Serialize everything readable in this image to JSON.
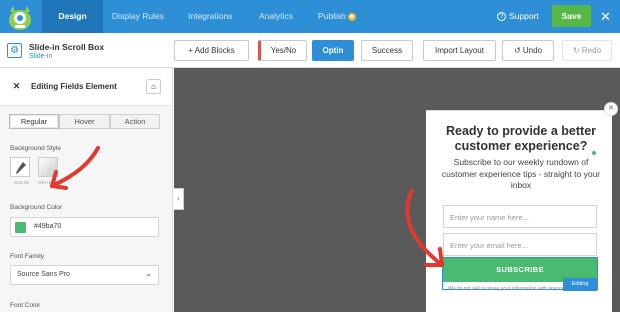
{
  "nav": {
    "tabs": [
      {
        "label": "Design",
        "active": true
      },
      {
        "label": "Display Rules"
      },
      {
        "label": "Integrations"
      },
      {
        "label": "Analytics"
      },
      {
        "label": "Publish"
      }
    ],
    "support_label": "Support",
    "save_label": "Save",
    "close_label": "✕",
    "brand_color": "#2e8fd6",
    "save_color": "#57b847"
  },
  "toolbar": {
    "campaign_name": "Slide-in Scroll Box",
    "campaign_type": "Slide-in",
    "add_blocks_label": "+ Add Blocks",
    "yes_no_label": "Yes/No",
    "optin_label": "Optin",
    "success_label": "Success",
    "import_layout_label": "Import Layout",
    "undo_label": "↺ Undo",
    "redo_label": "↻ Redo"
  },
  "sidebar": {
    "title": "Editing Fields Element",
    "tabs": [
      "Regular",
      "Hover",
      "Action"
    ],
    "background_style_label": "Background Style",
    "style_options": [
      "SOLID",
      "GRADIENT"
    ],
    "background_color_label": "Background Color",
    "background_color_value": "#49ba70",
    "font_family_label": "Font Family",
    "font_family_value": "Source Sans Pro",
    "font_color_label": "Font Color"
  },
  "preview": {
    "title": "Ready to provide a better customer experience?",
    "subtitle": "Subscribe to our weekly rundown of customer experience tips - straight to your inbox",
    "name_placeholder": "Enter your name here...",
    "email_placeholder": "Enter your email here...",
    "subscribe_label": "SUBSCRIBE",
    "editing_label": "Editing",
    "privacy_text": "We do not sell or share your information with anyone.",
    "accent_color": "#49ba70"
  }
}
